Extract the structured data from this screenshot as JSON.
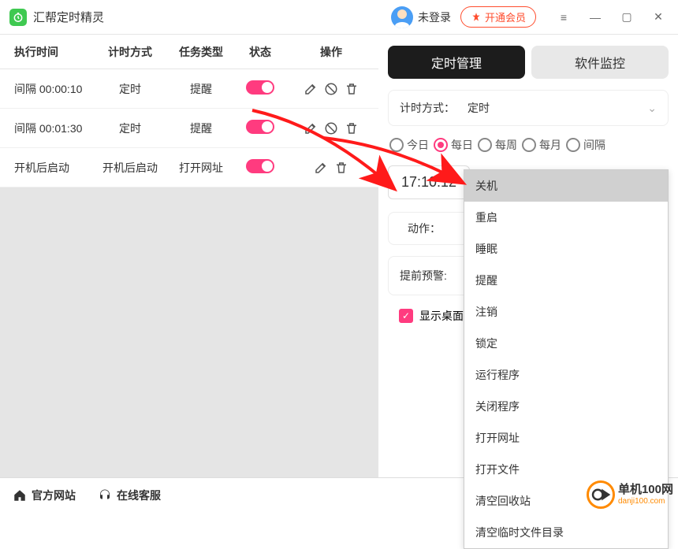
{
  "app": {
    "title": "汇帮定时精灵"
  },
  "header": {
    "login_status": "未登录",
    "vip_button": "开通会员"
  },
  "table": {
    "headers": {
      "time": "执行时间",
      "mode": "计时方式",
      "type": "任务类型",
      "status": "状态",
      "ops": "操作"
    },
    "rows": [
      {
        "time": "间隔 00:00:10",
        "mode": "定时",
        "type": "提醒",
        "toggle": true,
        "ops": [
          "edit",
          "disable",
          "delete"
        ]
      },
      {
        "time": "间隔 00:01:30",
        "mode": "定时",
        "type": "提醒",
        "toggle": true,
        "ops": [
          "edit",
          "disable",
          "delete"
        ]
      },
      {
        "time": "开机后启动",
        "mode": "开机后启动",
        "type": "打开网址",
        "toggle": true,
        "ops": [
          "edit",
          "delete"
        ]
      }
    ]
  },
  "right": {
    "tabs": {
      "active": "定时管理",
      "inactive": "软件监控"
    },
    "timer_mode_label": "计时方式：",
    "timer_mode_value": "定时",
    "freq": {
      "today": "今日",
      "daily": "每日",
      "weekly": "每周",
      "monthly": "每月",
      "interval": "间隔",
      "selected": "daily"
    },
    "time_value": "17:10:12",
    "action_label": "动作：",
    "warn_label": "提前预警:",
    "checkbox_label": "显示桌面"
  },
  "dropdown": {
    "items": [
      "关机",
      "重启",
      "睡眠",
      "提醒",
      "注销",
      "锁定",
      "运行程序",
      "关闭程序",
      "打开网址",
      "打开文件",
      "清空回收站",
      "清空临时文件目录"
    ],
    "hover_index": 0
  },
  "footer": {
    "site": "官方网站",
    "service": "在线客服"
  },
  "watermark": {
    "cn": "单机100网",
    "en": "danji100.com"
  }
}
